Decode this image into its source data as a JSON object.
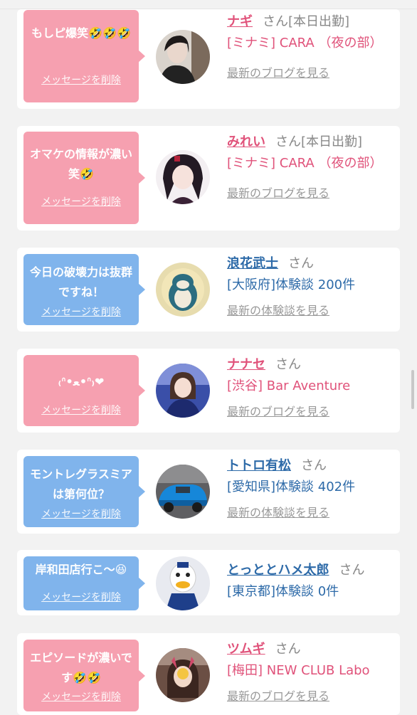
{
  "delete_label": "メッセージを削除",
  "san": "さん",
  "colors": {
    "pink": "#f6a0b0",
    "blue": "#80b4ec",
    "name_pink": "#e0527a",
    "name_blue": "#2d6aa8"
  },
  "cards": [
    {
      "msg": "もしピ爆笑🤣🤣🤣",
      "name": "ナギ",
      "tag": "[本日出勤]",
      "detail": "[ミナミ] CARA （夜の部）",
      "link": "最新のブログを見る"
    },
    {
      "msg": "オマケの情報が濃い笑🤣",
      "name": "みれい",
      "tag": "[本日出勤]",
      "detail": "[ミナミ] CARA （夜の部）",
      "link": "最新のブログを見る"
    },
    {
      "msg": "今日の破壊力は抜群ですね！",
      "name": "浪花武士",
      "tag": "",
      "detail": "[大阪府]体験談 200件",
      "link": "最新の体験談を見る"
    },
    {
      "msg": "₍ᐢ•ﻌ•ᐢ₎❤",
      "name": "ナナセ",
      "tag": "",
      "detail": "[渋谷] Bar Aventure",
      "link": "最新のブログを見る"
    },
    {
      "msg": "モントレグラスミアは第何位？",
      "name": "トトロ有松",
      "tag": "",
      "detail": "[愛知県]体験談 402件",
      "link": "最新の体験談を見る"
    },
    {
      "msg": "岸和田店行こ〜😆",
      "name": "とっととハメ太郎",
      "tag": "",
      "detail": "[東京都]体験談 0件",
      "link": ""
    },
    {
      "msg": "エピソードが濃いです🤣🤣",
      "name": "ツムギ",
      "tag": "",
      "detail": "[梅田] NEW CLUB Labo",
      "link": "最新のブログを見る"
    }
  ]
}
